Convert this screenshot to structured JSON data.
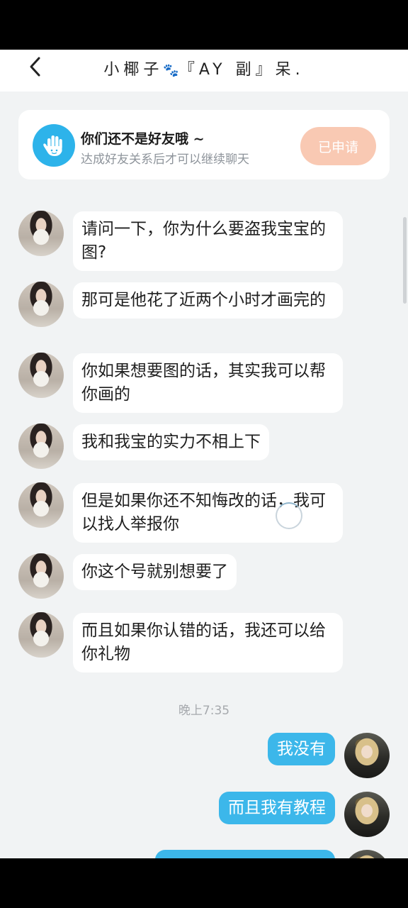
{
  "header": {
    "back_icon": "chevron-left-icon",
    "title_before": "小椰子",
    "paw_icon": "🐾",
    "title_after": "『AY 副』呆."
  },
  "friend_card": {
    "icon": "waving-hand-icon",
    "title": "你们还不是好友哦 ~",
    "subtitle": "达成好友关系后才可以继续聊天",
    "button_label": "已申请",
    "button_color": "#f9c9b3",
    "icon_bg": "#2db3ea"
  },
  "messages_in": [
    "请问一下，你为什么要盗我宝宝的图?",
    "那可是他花了近两个小时才画完的",
    "你如果想要图的话，其实我可以帮你画的",
    "我和我宝的实力不相上下",
    "但是如果你还不知悔改的话，我可以找人举报你",
    "你这个号就别想要了",
    "而且如果你认错的话，我还可以给你礼物"
  ],
  "timestamp": "晚上7:35",
  "messages_out": [
    "我没有",
    "而且我有教程"
  ],
  "colors": {
    "outgoing_bubble": "#3cb7ea",
    "chat_background": "#f1f3f4"
  }
}
